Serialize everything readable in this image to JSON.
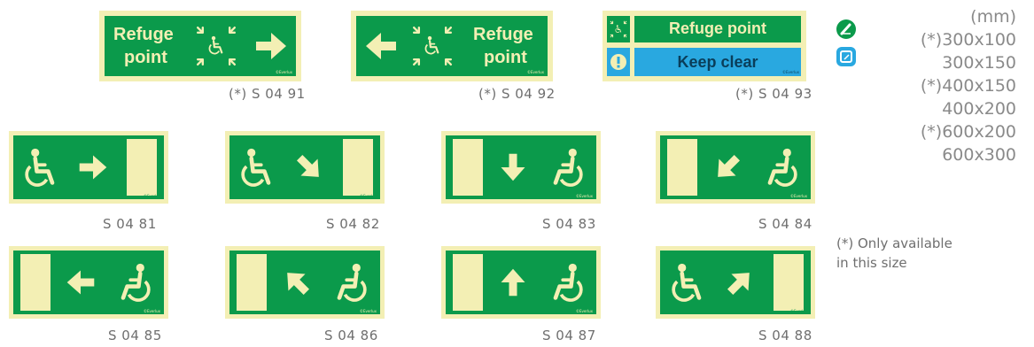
{
  "colors": {
    "green": "#0b9a4b",
    "pale": "#f3efb4",
    "blue": "#29a8e0",
    "code_text": "#6f6f6f"
  },
  "brand": "©Everlux",
  "refuge_signs": [
    {
      "line1": "Refuge",
      "line2": "point",
      "code": "(*) S 04 91"
    },
    {
      "line1": "Refuge",
      "line2": "point",
      "code": "(*) S 04 92"
    },
    {
      "row1": "Refuge point",
      "row2": "Keep clear",
      "code": "(*) S 04 93"
    }
  ],
  "wheelchair_signs": [
    {
      "code": "S 04 81",
      "arrow": "right"
    },
    {
      "code": "S 04 82",
      "arrow": "down-right"
    },
    {
      "code": "S 04 83",
      "arrow": "down"
    },
    {
      "code": "S 04 84",
      "arrow": "down-left"
    },
    {
      "code": "S 04 85",
      "arrow": "left"
    },
    {
      "code": "S 04 86",
      "arrow": "up-left"
    },
    {
      "code": "S 04 87",
      "arrow": "up"
    },
    {
      "code": "S 04 88",
      "arrow": "up-right"
    }
  ],
  "sizes": {
    "unit": "(mm)",
    "list": [
      "(*)300x100",
      "300x150",
      "(*)400x150",
      "400x200",
      "(*)600x200",
      "600x300"
    ]
  },
  "footnote": {
    "line1": "(*) Only available",
    "line2": "in this size"
  },
  "badges": [
    {
      "icon": "photoluminescent-icon",
      "color": "#0b9a4b"
    },
    {
      "icon": "rigid-plate-icon",
      "color": "#29a8e0"
    }
  ]
}
